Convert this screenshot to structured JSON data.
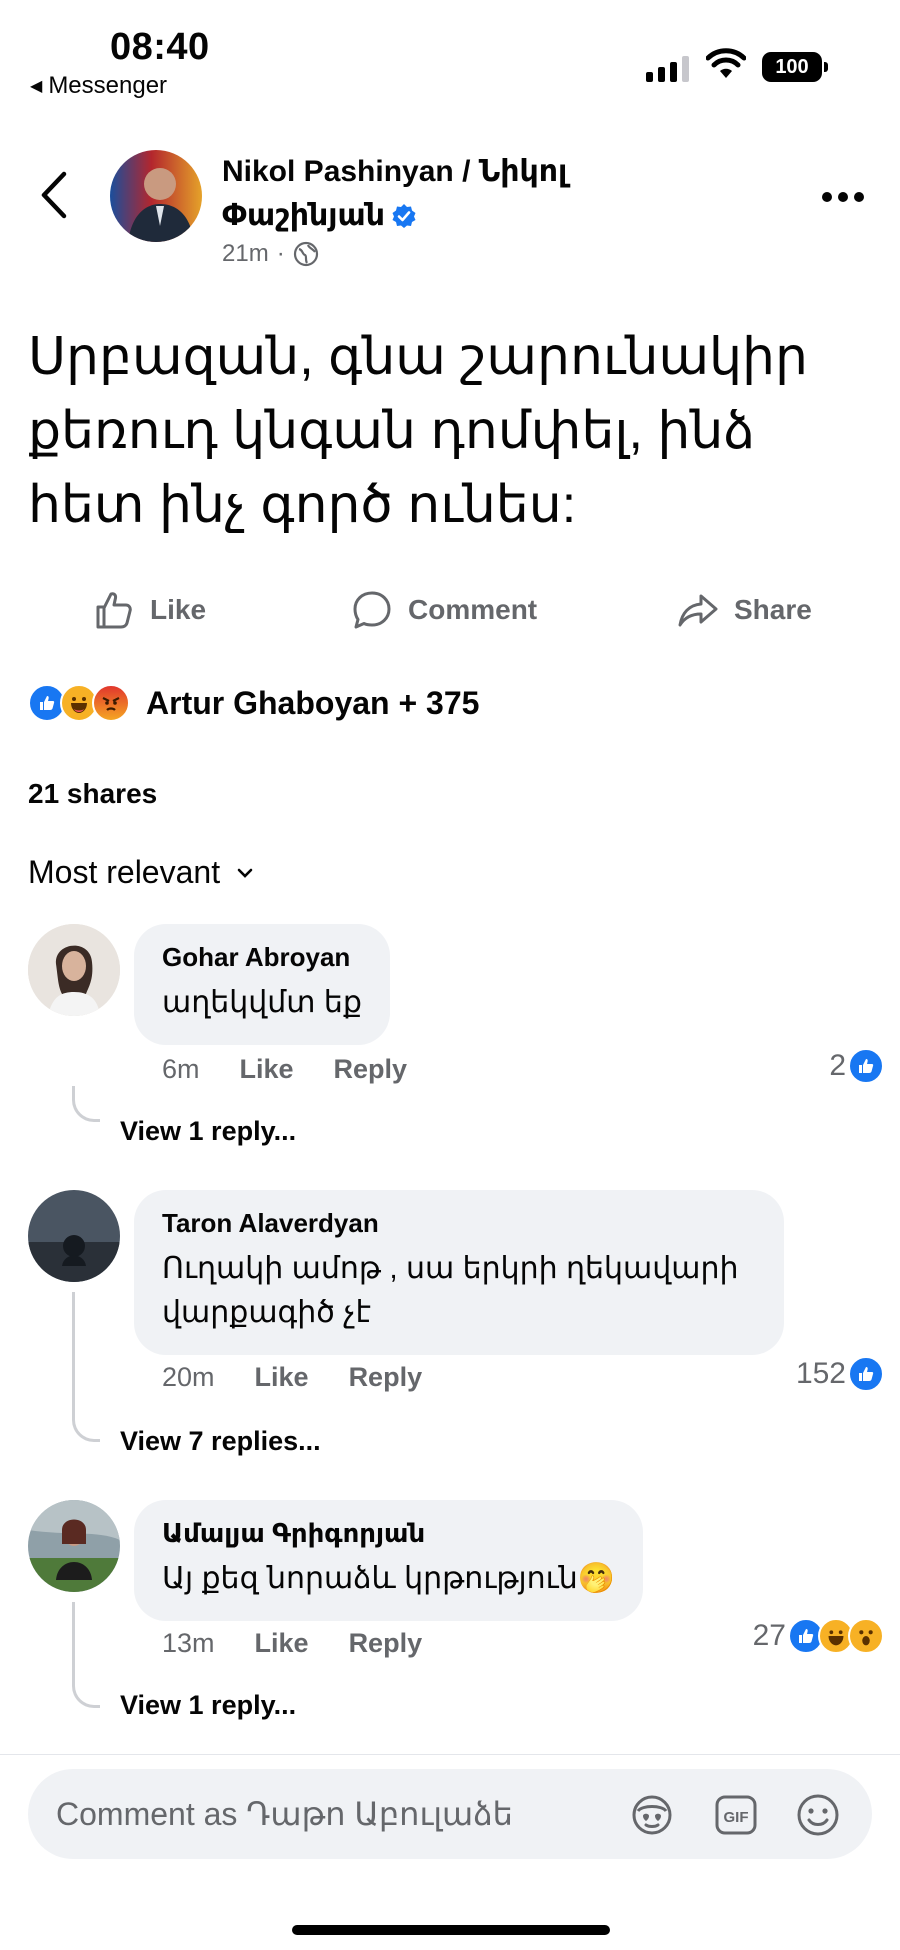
{
  "status_bar": {
    "time": "08:40",
    "back_app": "Messenger",
    "battery": "100"
  },
  "post": {
    "author": "Nikol Pashinyan / Նիկոլ Փաշինյան",
    "time": "21m",
    "privacy_icon": "globe-icon",
    "text": "Սրբազան, գնա շարունակիր քեռուդ կնգան դոմփել, ինձ հետ ինչ գործ ունես:"
  },
  "actions": {
    "like": "Like",
    "comment": "Comment",
    "share": "Share"
  },
  "reactions": {
    "summary": "Artur Ghaboyan + 375",
    "types": [
      "like",
      "haha",
      "angry"
    ]
  },
  "shares": "21 shares",
  "sort": {
    "label": "Most relevant"
  },
  "comments": [
    {
      "author": "Gohar Abroyan",
      "text": "աղեկվմտ եք",
      "time": "6m",
      "like": "Like",
      "reply": "Reply",
      "reaction_count": "2",
      "view_replies": "View 1 reply..."
    },
    {
      "author": "Taron Alaverdyan",
      "text": "Ուղակի ամոթ , սա երկրի ղեկավարի վարքագիծ չէ",
      "time": "20m",
      "like": "Like",
      "reply": "Reply",
      "reaction_count": "152",
      "view_replies": "View 7 replies..."
    },
    {
      "author": "Ամալյա Գրիգորյան",
      "text": "Այ քեզ նորաձև կրթություն🤭",
      "time": "13m",
      "like": "Like",
      "reply": "Reply",
      "reaction_count": "27",
      "view_replies": "View 1 reply..."
    }
  ],
  "footer": {
    "placeholder": "Comment as Դաթո Աբուլաձե"
  }
}
